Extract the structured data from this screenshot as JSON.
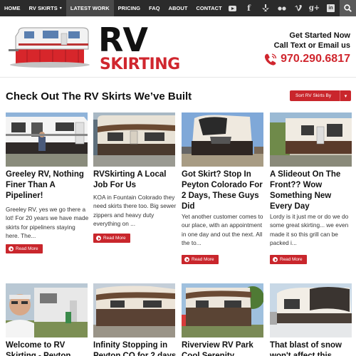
{
  "nav": {
    "items": [
      {
        "label": "HOME"
      },
      {
        "label": "RV SKIRTS",
        "caret": "▾"
      },
      {
        "label": "LATEST WORK"
      },
      {
        "label": "PRICING"
      },
      {
        "label": "FAQ"
      },
      {
        "label": "ABOUT"
      },
      {
        "label": "CONTACT"
      }
    ],
    "social_icons": [
      "youtube-icon",
      "facebook-icon",
      "yelp-icon",
      "flickr-icon",
      "vimeo-icon",
      "google-plus-icon",
      "linkedin-icon"
    ],
    "gplus_text": "g+",
    "linkedin_text": "in",
    "facebook_text": "f",
    "search_icon": "search-icon"
  },
  "header": {
    "logo_rv": "RV",
    "logo_skirting": "SKIRTING",
    "cta_line1": "Get Started Now",
    "cta_line2": "Call Text or Email us",
    "phone": "970.290.6817"
  },
  "section": {
    "title": "Check Out The RV Skirts We’ve Built",
    "sort_label": "Sort RV Skirts By",
    "sort_caret": "▾"
  },
  "posts": [
    {
      "title": "Greeley RV, Nothing Finer Than A Pipeliner!",
      "excerpt": "Greeley RV, yes we go there a lot! For 20 years we have made skirts for pipeliners staying here. The...",
      "read_more": "Read More"
    },
    {
      "title": "RVSkirting A Local Job For Us",
      "excerpt": "KOA in Fountain Colorado they need skirts there too. Big sewer zippers and heavy duty everything on ...",
      "read_more": "Read More"
    },
    {
      "title": "Got Skirt? Stop In Peyton Colorado For 2 Days, These Guys Did",
      "excerpt": "Yet another customer comes to our place, with an appointment in one day and out the next. All the to...",
      "read_more": "Read More"
    },
    {
      "title": "A Slideout On The Front?? Wow Something New Every Day",
      "excerpt": "Lordy is it just me or do we do some great skirting... we even made it so this grill can be packed i...",
      "read_more": "Read More"
    },
    {
      "title": "Welcome to RV Skirting - Peyton"
    },
    {
      "title": "Infinity Stopping in Peyton CO for 2 days"
    },
    {
      "title": "Riverview RV Park Cool Serenity"
    },
    {
      "title": "That blast of snow won't affect this"
    }
  ],
  "colors": {
    "accent": "#c9262c",
    "nav_bg": "#2b2b2b"
  }
}
